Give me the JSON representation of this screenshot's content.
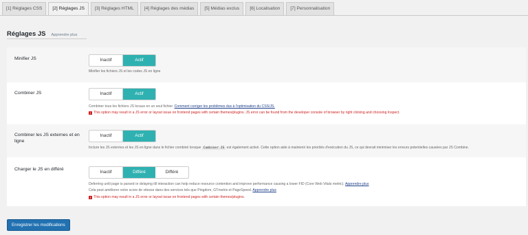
{
  "tabs": [
    {
      "label": "[1] Réglages CSS",
      "active": false
    },
    {
      "label": "[2] Réglages JS",
      "active": true
    },
    {
      "label": "[3] Réglages HTML",
      "active": false
    },
    {
      "label": "[4] Réglages des médias",
      "active": false
    },
    {
      "label": "[5] Médias exclus",
      "active": false
    },
    {
      "label": "[6] Localisation",
      "active": false
    },
    {
      "label": "[7] Personnalisation",
      "active": false
    }
  ],
  "section": {
    "title": "Réglages JS",
    "learn_more": "Apprendre plus"
  },
  "settings": {
    "minify": {
      "label": "Minifier JS",
      "options": [
        "Inactif",
        "Actif"
      ],
      "selected": "Actif",
      "description": "Minifier les fichiers JS et les codes JS en ligne"
    },
    "combine": {
      "label": "Combiner JS",
      "options": [
        "Inactif",
        "Actif"
      ],
      "selected": "Actif",
      "description": "Combiner tous les fichiers JS locaux en un seul fichier.",
      "link": "Comment corriger les problèmes dus à l'optimisation du CSS/JS.",
      "warning": "This option may result in a JS error or layout issue on frontend pages with certain themes/plugins. JS error can be found from the developer console of browser by right clicking and choosing Inspect."
    },
    "combine_external": {
      "label": "Combiner les JS externes et en ligne",
      "options": [
        "Inactif",
        "Actif"
      ],
      "selected": "Actif",
      "description_before": "Inclure les JS externes et les JS en ligne dans le fichier combiné lorsque",
      "code": "Combiner JS",
      "description_after": "est également activé. Cette option aide à maintenir les priorités d'exécution du JS, ce qui devrait minimiser les erreurs potentielles causées par JS Combine."
    },
    "defer": {
      "label": "Charger le JS en différé",
      "options": [
        "Inactif",
        "Différé",
        "Différé"
      ],
      "selected_index": 1,
      "description_line1": "Deferring until page is parsed or delaying till interaction can help reduce resource contention and improve performance causing a lower FID (Core Web Vitals metric).",
      "line1_link": "Apprendre plus",
      "description_line2": "Cela peut améliorer votre score de vitesse dans des services tels que Pingdom, GTmetrix et PageSpeed.",
      "line2_link": "Apprendre plus",
      "warning": "This option may result in a JS error or layout issue on frontend pages with certain themes/plugins."
    }
  },
  "save_button": "Enregistrer les modifications"
}
